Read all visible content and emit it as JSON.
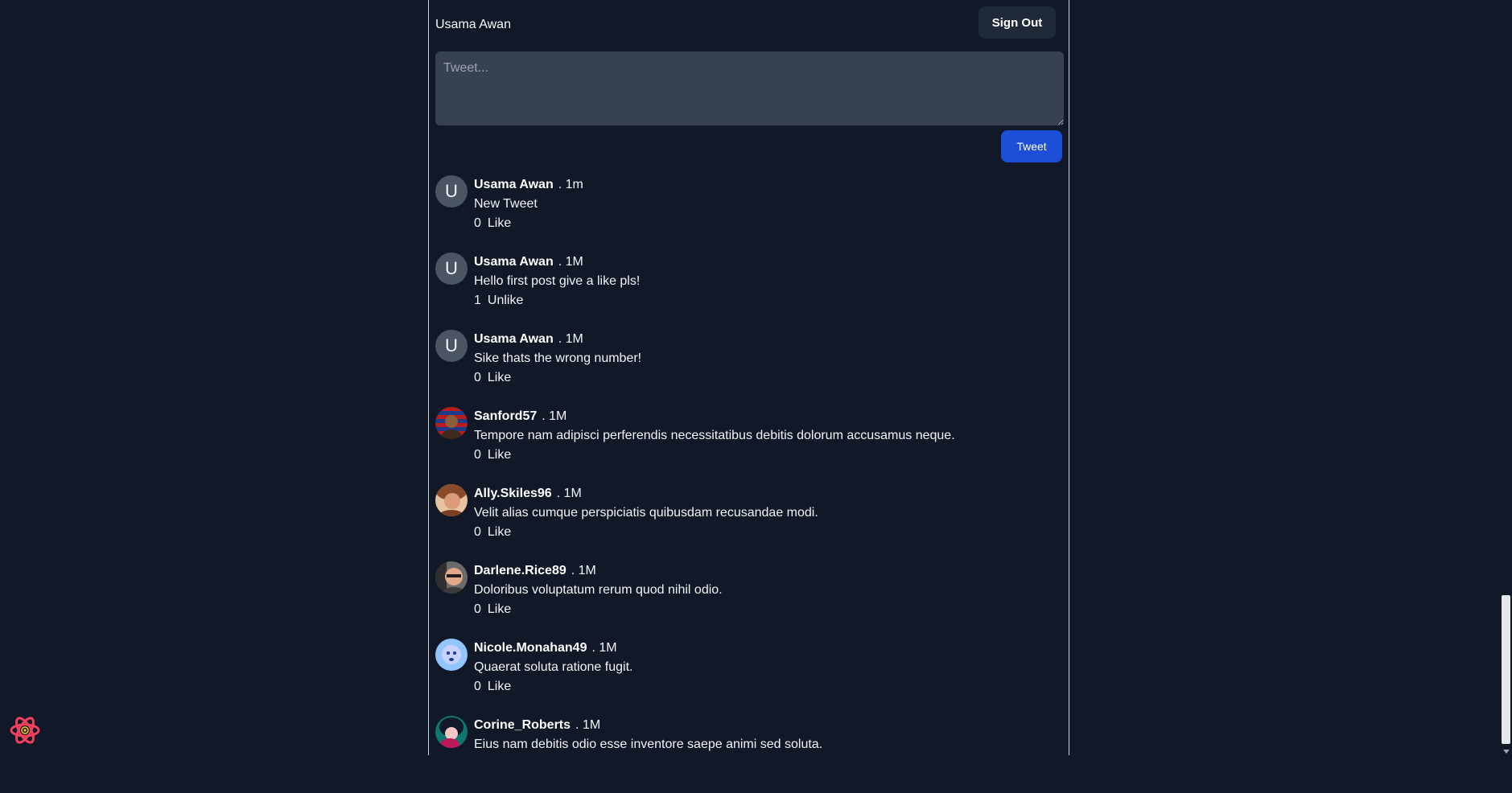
{
  "header": {
    "username": "Usama Awan",
    "signout_label": "Sign Out"
  },
  "composer": {
    "placeholder": "Tweet...",
    "tweet_label": "Tweet"
  },
  "posts": [
    {
      "author": "Usama Awan",
      "time": ". 1m",
      "text": "New Tweet",
      "likes": "0",
      "action": "Like",
      "avatar": "U"
    },
    {
      "author": "Usama Awan",
      "time": ". 1M",
      "text": "Hello first post give a like pls!",
      "likes": "1",
      "action": "Unlike",
      "avatar": "U"
    },
    {
      "author": "Usama Awan",
      "time": ". 1M",
      "text": "Sike thats the wrong number!",
      "likes": "0",
      "action": "Like",
      "avatar": "U"
    },
    {
      "author": "Sanford57",
      "time": ". 1M",
      "text": "Tempore nam adipisci perferendis necessitatibus debitis dolorum accusamus neque.",
      "likes": "0",
      "action": "Like",
      "avatar": "photo",
      "avatar_color": "#7f1d1d"
    },
    {
      "author": "Ally.Skiles96",
      "time": ". 1M",
      "text": "Velit alias cumque perspiciatis quibusdam recusandae modi.",
      "likes": "0",
      "action": "Like",
      "avatar": "photo",
      "avatar_color": "#a16249"
    },
    {
      "author": "Darlene.Rice89",
      "time": ". 1M",
      "text": "Doloribus voluptatum rerum quod nihil odio.",
      "likes": "0",
      "action": "Like",
      "avatar": "photo",
      "avatar_color": "#9a7b6b"
    },
    {
      "author": "Nicole.Monahan49",
      "time": ". 1M",
      "text": "Quaerat soluta ratione fugit.",
      "likes": "0",
      "action": "Like",
      "avatar": "photo",
      "avatar_color": "#60a5fa"
    },
    {
      "author": "Corine_Roberts",
      "time": ". 1M",
      "text": "Eius nam debitis odio esse inventore saepe animi sed soluta.",
      "likes": "",
      "action": "",
      "avatar": "photo",
      "avatar_color": "#0e7490"
    }
  ]
}
